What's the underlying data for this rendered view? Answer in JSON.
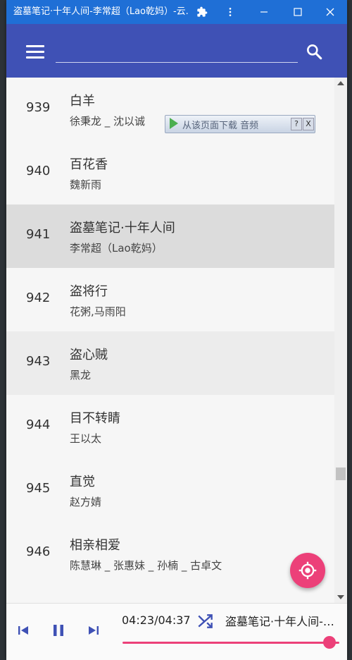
{
  "window": {
    "title": "盗墓笔记·十年人间-李常超（Lao乾妈）-云..."
  },
  "search": {
    "value": "",
    "placeholder": ""
  },
  "list": {
    "rows": [
      {
        "num": "939",
        "song": "白羊",
        "artist": "徐秉龙 _ 沈以诚",
        "state": "normal"
      },
      {
        "num": "940",
        "song": "百花香",
        "artist": "魏新雨",
        "state": "normal"
      },
      {
        "num": "941",
        "song": "盗墓笔记·十年人间",
        "artist": "李常超（Lao乾妈）",
        "state": "selected"
      },
      {
        "num": "942",
        "song": "盗将行",
        "artist": "花粥,马雨阳",
        "state": "normal"
      },
      {
        "num": "943",
        "song": "盗心贼",
        "artist": "黑龙",
        "state": "hover"
      },
      {
        "num": "944",
        "song": "目不转睛",
        "artist": "王以太",
        "state": "normal"
      },
      {
        "num": "945",
        "song": "直觉",
        "artist": "赵方婧",
        "state": "normal"
      },
      {
        "num": "946",
        "song": "相亲相爱",
        "artist": "陈慧琳 _ 张惠妹 _ 孙楠 _ 古卓文",
        "state": "normal"
      }
    ]
  },
  "download_bar": {
    "label": "从该页面下载 音频",
    "help": "?",
    "close": "X"
  },
  "player": {
    "time": "04:23/04:37",
    "now_playing": "盗墓笔记·十年人间-李常超（Lao乾妈）",
    "progress": 0.955
  },
  "colors": {
    "titlebar": "#1f6fd6",
    "appbar": "#3f51b5",
    "accent": "#ec4079",
    "selected_row": "#dcdcdc",
    "hover_row": "#ececec"
  },
  "icons": {
    "menu": "menu-icon",
    "search": "search-icon",
    "extensions": "puzzle-icon",
    "more": "more-vert-icon",
    "minimize": "minimize-icon",
    "maximize": "maximize-icon",
    "close": "close-icon",
    "locate": "locate-icon",
    "previous": "skip-previous-icon",
    "pause": "pause-icon",
    "next": "skip-next-icon",
    "shuffle": "shuffle-icon"
  }
}
